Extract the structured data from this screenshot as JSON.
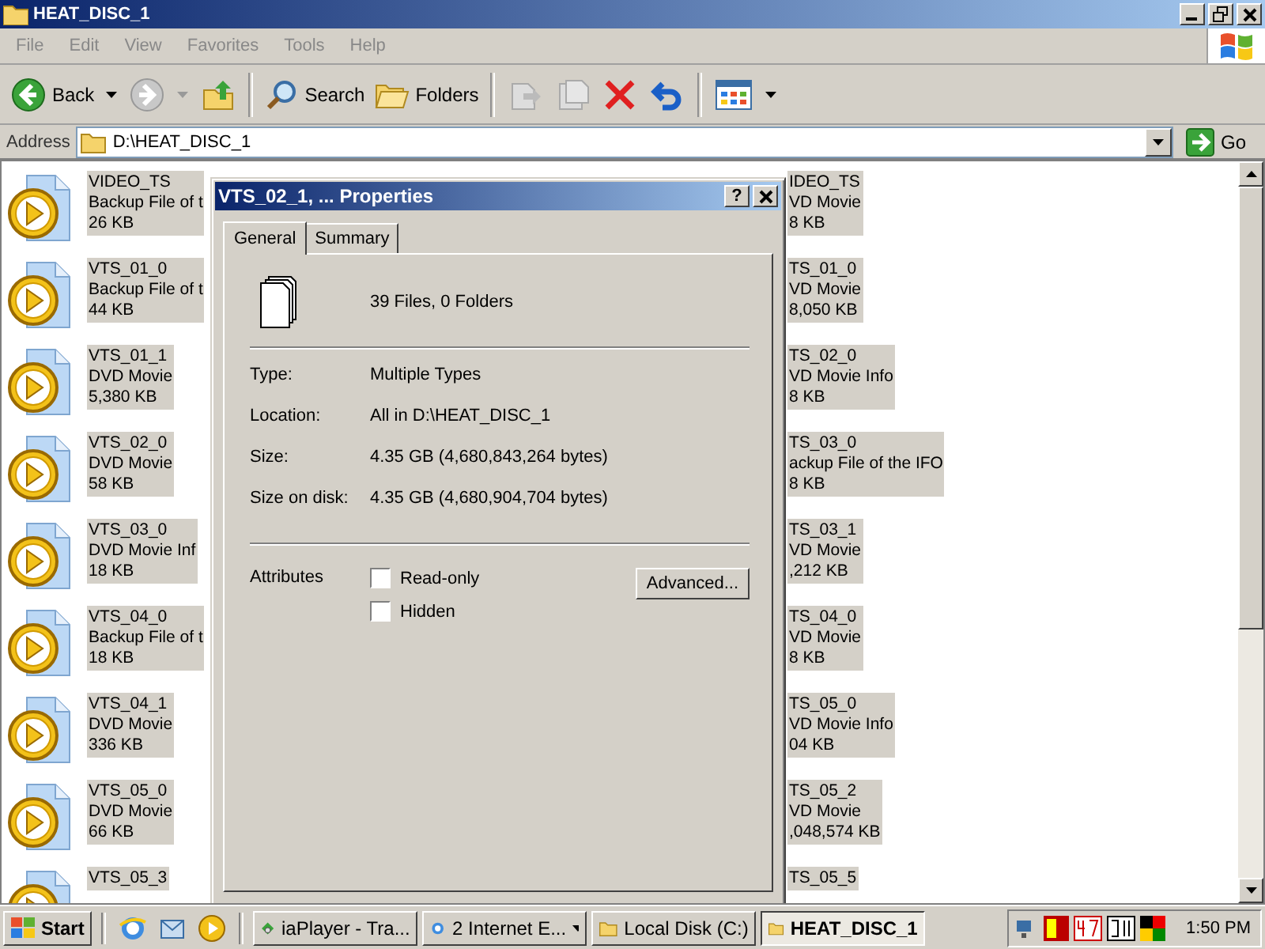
{
  "window": {
    "title": "HEAT_DISC_1"
  },
  "menu": [
    "File",
    "Edit",
    "View",
    "Favorites",
    "Tools",
    "Help"
  ],
  "toolbar": {
    "back": "Back",
    "search": "Search",
    "folders": "Folders"
  },
  "address": {
    "label": "Address",
    "value": "D:\\HEAT_DISC_1",
    "go": "Go"
  },
  "files_left": [
    {
      "name": "VIDEO_TS",
      "type": "Backup File of t",
      "size": "26 KB",
      "selected": true
    },
    {
      "name": "VTS_01_0",
      "type": "Backup File of t",
      "size": "44 KB",
      "selected": true
    },
    {
      "name": "VTS_01_1",
      "type": "DVD Movie",
      "size": "5,380 KB",
      "selected": true
    },
    {
      "name": "VTS_02_0",
      "type": "DVD Movie",
      "size": "58 KB",
      "selected": true
    },
    {
      "name": "VTS_03_0",
      "type": "DVD Movie Inf",
      "size": "18 KB",
      "selected": true
    },
    {
      "name": "VTS_04_0",
      "type": "Backup File of t",
      "size": "18 KB",
      "selected": true
    },
    {
      "name": "VTS_04_1",
      "type": "DVD Movie",
      "size": "336 KB",
      "selected": true
    },
    {
      "name": "VTS_05_0",
      "type": "DVD Movie",
      "size": "66 KB",
      "selected": true
    },
    {
      "name": "VTS_05_3",
      "selected": true
    }
  ],
  "files_right": [
    {
      "name": "IDEO_TS",
      "type": "VD Movie",
      "size": "8 KB",
      "selected": true
    },
    {
      "name": "TS_01_0",
      "type": "VD Movie",
      "size": "8,050 KB",
      "selected": true
    },
    {
      "name": "TS_02_0",
      "type": "VD Movie Info",
      "size": "8 KB",
      "selected": true
    },
    {
      "name": "TS_03_0",
      "type": "ackup File of the IFO",
      "size": "8 KB",
      "selected": true
    },
    {
      "name": "TS_03_1",
      "type": "VD Movie",
      "size": ",212 KB",
      "selected": true
    },
    {
      "name": "TS_04_0",
      "type": "VD Movie",
      "size": "8 KB",
      "selected": true
    },
    {
      "name": "TS_05_0",
      "type": "VD Movie Info",
      "size": "04 KB",
      "selected": true
    },
    {
      "name": "TS_05_2",
      "type": "VD Movie",
      "size": ",048,574 KB",
      "selected": true
    },
    {
      "name": "TS_05_5",
      "selected": true
    }
  ],
  "dialog": {
    "title": "VTS_02_1, ... Properties",
    "help": "?",
    "tabs": [
      {
        "label": "General",
        "selected": true
      },
      {
        "label": "Summary",
        "selected": false
      }
    ],
    "summary": "39 Files, 0 Folders",
    "properties": [
      {
        "label": "Type:",
        "value": "Multiple Types"
      },
      {
        "label": "Location:",
        "value": "All in D:\\HEAT_DISC_1"
      },
      {
        "label": "Size:",
        "value": "4.35 GB (4,680,843,264 bytes)"
      },
      {
        "label": "Size on disk:",
        "value": "4.35 GB (4,680,904,704 bytes)"
      }
    ],
    "attributes_label": "Attributes",
    "attributes": [
      {
        "label": "Read-only",
        "checked": false
      },
      {
        "label": "Hidden",
        "checked": false
      }
    ],
    "advanced": "Advanced..."
  },
  "taskbar": {
    "start": "Start",
    "tasks": [
      {
        "label": "iaPlayer - Tra...",
        "kind": "player",
        "selected": false
      },
      {
        "label": "2 Internet E...",
        "kind": "ie",
        "selected": false
      },
      {
        "label": "Local Disk (C:)",
        "kind": "folder",
        "selected": false
      },
      {
        "label": "HEAT_DISC_1",
        "kind": "folder",
        "selected": true
      }
    ],
    "clock": "1:50 PM"
  }
}
